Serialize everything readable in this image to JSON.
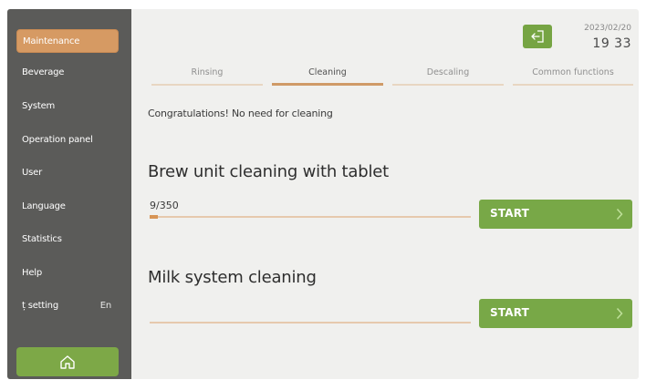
{
  "sidebar": {
    "items": [
      {
        "label": "Maintenance",
        "active": true
      },
      {
        "label": "Beverage"
      },
      {
        "label": "System"
      },
      {
        "label": "Operation panel"
      },
      {
        "label": "User"
      },
      {
        "label": "Language"
      },
      {
        "label": "Statistics"
      },
      {
        "label": "Help"
      },
      {
        "label": "ț setting",
        "value": "En"
      }
    ],
    "home_icon": "home-icon"
  },
  "header": {
    "exit_icon": "exit-icon",
    "date": "2023/02/20",
    "time": "19 33"
  },
  "tabs": [
    {
      "label": "Rinsing"
    },
    {
      "label": "Cleaning",
      "active": true
    },
    {
      "label": "Descaling"
    },
    {
      "label": "Common functions"
    }
  ],
  "notice": "Congratulations! No need for cleaning",
  "sections": [
    {
      "title": "Brew unit cleaning with tablet",
      "counter": "9/350",
      "progress": 0.026,
      "button": "START"
    },
    {
      "title": "Milk system cleaning",
      "progress": 0,
      "button": "START"
    }
  ],
  "colors": {
    "accent": "#d69a63",
    "button_green": "#78a847",
    "sidebar": "#5b5b59",
    "background": "#f0f0ee"
  }
}
